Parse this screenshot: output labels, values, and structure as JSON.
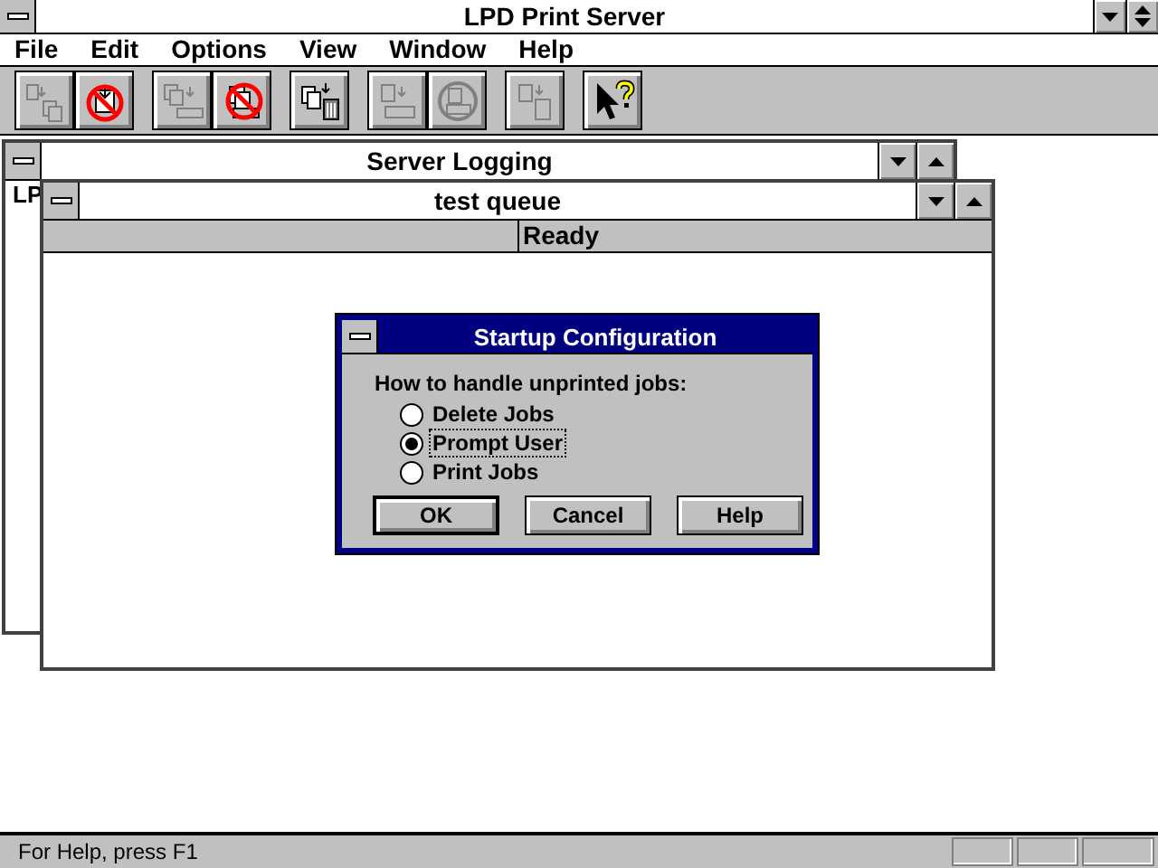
{
  "window": {
    "title": "LPD Print Server"
  },
  "menu": [
    {
      "label": "File"
    },
    {
      "label": "Edit"
    },
    {
      "label": "Options"
    },
    {
      "label": "View"
    },
    {
      "label": "Window"
    },
    {
      "label": "Help"
    }
  ],
  "toolbar": [
    [
      {
        "kind": "copy-stack",
        "disabled": true
      },
      {
        "kind": "no-copy",
        "disabled": false
      }
    ],
    [
      {
        "kind": "print-stack",
        "disabled": true
      },
      {
        "kind": "no-print",
        "disabled": false
      }
    ],
    [
      {
        "kind": "trash-stack",
        "disabled": false
      }
    ],
    [
      {
        "kind": "print",
        "disabled": true
      },
      {
        "kind": "print-pause",
        "disabled": true
      }
    ],
    [
      {
        "kind": "trash",
        "disabled": true
      }
    ],
    [
      {
        "kind": "help-pointer",
        "disabled": false
      }
    ]
  ],
  "server_logging": {
    "title": "Server Logging",
    "content": "LP"
  },
  "queue": {
    "title": "test queue",
    "status": "Ready"
  },
  "dialog": {
    "title": "Startup Configuration",
    "prompt": "How to handle unprinted jobs:",
    "options": [
      {
        "label": "Delete Jobs",
        "selected": false
      },
      {
        "label": "Prompt User",
        "selected": true
      },
      {
        "label": "Print Jobs",
        "selected": false
      }
    ],
    "buttons": [
      {
        "label": "OK",
        "default": true
      },
      {
        "label": "Cancel",
        "default": false
      },
      {
        "label": "Help",
        "default": false
      }
    ]
  },
  "status_bar": {
    "text": "For Help, press F1"
  }
}
